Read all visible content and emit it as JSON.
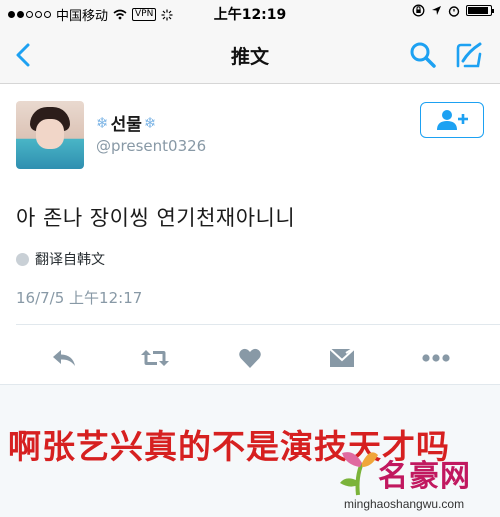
{
  "status_bar": {
    "carrier": "中国移动",
    "vpn": "VPN",
    "time": "上午12:19"
  },
  "nav": {
    "title": "推文",
    "icons": [
      "back-chevron-icon",
      "search-icon",
      "compose-icon"
    ]
  },
  "tweet": {
    "display_name": "선물",
    "name_decoration": "❄",
    "handle": "@present0326",
    "text": "아 존나 장이씽 연기천재아니니",
    "translate_label": "翻译自韩文",
    "timestamp": "16/7/5 上午12:17",
    "actions": [
      "reply-icon",
      "retweet-icon",
      "like-icon",
      "dm-icon",
      "more-icon"
    ]
  },
  "caption": "啊张艺兴真的不是演技天才吗",
  "watermark": {
    "name": "名豪网",
    "url": "minghaoshangwu.com"
  },
  "colors": {
    "twitter_blue": "#1da1f2",
    "icon_gray": "#8899a6",
    "caption_red": "#d62020",
    "watermark_red": "#c1185f"
  }
}
